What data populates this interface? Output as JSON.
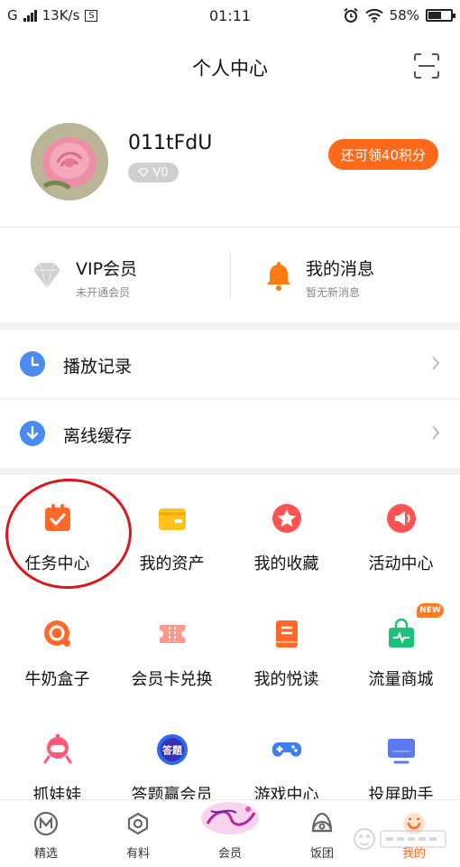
{
  "status_bar": {
    "carrier": "G",
    "speed": "13K/s",
    "speed_badge": "S",
    "time": "01:11",
    "battery_percent": "58%",
    "battery_level": 0.58
  },
  "header": {
    "title": "个人中心",
    "scan_icon": "scan-icon"
  },
  "profile": {
    "username": "011tFdU",
    "vip_level": "V0",
    "points_button": "还可领40积分"
  },
  "vip_card": {
    "title": "VIP会员",
    "subtitle": "未开通会员"
  },
  "messages_card": {
    "title": "我的消息",
    "subtitle": "暂无新消息"
  },
  "list": [
    {
      "label": "播放记录",
      "icon": "clock-icon"
    },
    {
      "label": "离线缓存",
      "icon": "download-icon"
    }
  ],
  "grid": [
    {
      "label": "任务中心",
      "icon": "task-icon"
    },
    {
      "label": "我的资产",
      "icon": "wallet-icon"
    },
    {
      "label": "我的收藏",
      "icon": "star-icon"
    },
    {
      "label": "活动中心",
      "icon": "megaphone-icon"
    },
    {
      "label": "牛奶盒子",
      "icon": "milk-box-icon"
    },
    {
      "label": "会员卡兑换",
      "icon": "ticket-icon"
    },
    {
      "label": "我的悦读",
      "icon": "book-icon"
    },
    {
      "label": "流量商城",
      "icon": "shopping-bag-icon"
    },
    {
      "label": "抓娃娃",
      "icon": "claw-machine-icon"
    },
    {
      "label": "答题赢会员",
      "icon": "quiz-icon"
    },
    {
      "label": "游戏中心",
      "icon": "gamepad-icon"
    },
    {
      "label": "投屏助手",
      "icon": "screen-cast-icon"
    }
  ],
  "new_badge": "NEW",
  "quiz_icon_text": "答题",
  "bottom_nav": [
    {
      "label": "精选",
      "icon": "featured-icon"
    },
    {
      "label": "有料",
      "icon": "discover-icon"
    },
    {
      "label": "会员",
      "icon": "member-icon"
    },
    {
      "label": "饭团",
      "icon": "rice-ball-icon"
    },
    {
      "label": "我的",
      "icon": "profile-icon",
      "active": true
    }
  ],
  "colors": {
    "accent": "#ff6a1a",
    "blue": "#4a8bf0",
    "annotation": "#d7191f"
  }
}
